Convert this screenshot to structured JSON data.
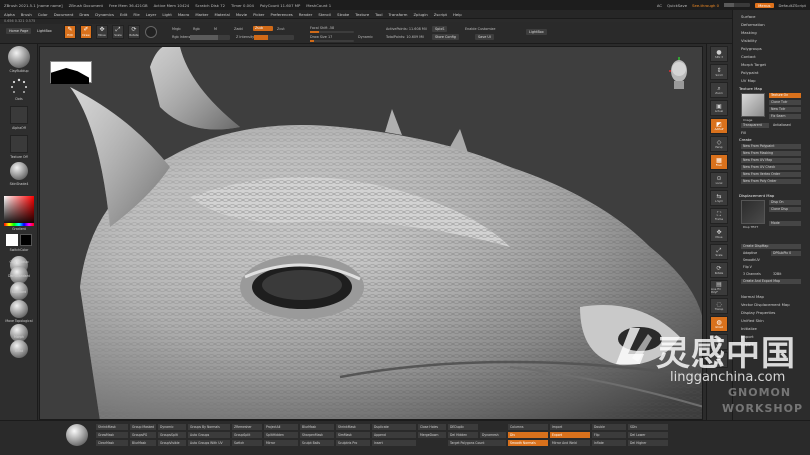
{
  "titlebar": {
    "app": "ZBrush 2021.5.1 [name name]",
    "doc": "ZBrush Document",
    "stats": [
      "Free Mem 36.421GB",
      "Active Mem 10424",
      "Scratch Disk 72",
      "Timer 0.004",
      "PolyCount 11.607 MP",
      "MeshCount 1"
    ],
    "ac": "AC",
    "quicksave": "QuickSave",
    "seethrough": "See-through 0",
    "menus": "Menus",
    "defaultzscript": "DefaultZScript"
  },
  "menubar": {
    "items": [
      "Alpha",
      "Brush",
      "Color",
      "Document",
      "Draw",
      "Dynamics",
      "Edit",
      "File",
      "Layer",
      "Light",
      "Macro",
      "Marker",
      "Material",
      "Movie",
      "Picker",
      "Preferences",
      "Render",
      "Stencil",
      "Stroke",
      "Texture",
      "Tool",
      "Transform",
      "Zplugin",
      "Zscript",
      "Help"
    ]
  },
  "infobar": "0.656 0.321 0.575",
  "toolbar": {
    "homepage": "Home Page",
    "lightbox": "LightBox",
    "edit": "Edit",
    "draw": "Draw",
    "move": "Move",
    "scale": "Scale",
    "rotate": "Rotate",
    "mrgb": "Mrgb",
    "rgb": "Rgb",
    "m": "M",
    "zadd": "Zadd",
    "zsub": "Zsub",
    "zcut": "Zcut",
    "rgb_intensity": "Rgb Intensity",
    "z_intensity": "Z Intensity 34",
    "focal_shift": "Focal Shift -58",
    "draw_size": "Draw Size 17",
    "dynamic": "Dynamic",
    "active_points": "ActivePoints: 11.608 Mil",
    "total_points": "TotalPoints: 10.609 Mil",
    "spix": "SpixS",
    "enable_customize": "Enable Customize",
    "store_config": "Store Config",
    "save_ui": "Save UI",
    "lightbox2": "LightBox"
  },
  "leftshelf": {
    "items": [
      "ClayBuildup",
      "Dots",
      "AlphaOff",
      "Texture Off",
      "SkinShade4",
      "Gradient",
      "SwitchColor",
      "ClayBuildup",
      "DamStandard",
      "Standard",
      "Move Topological",
      "Morph",
      "Inflat"
    ]
  },
  "rightshelf": {
    "items": [
      "SPix 3",
      "Scroll",
      "Zoom",
      "Actual",
      "AAHalf",
      "Persp",
      "Floor",
      "Local",
      "L.Sym",
      "Frame",
      "Move",
      "Scale",
      "Rotate",
      "Line Fill PolyF",
      "Transp",
      "Ghost",
      "Solo",
      "Xpose"
    ]
  },
  "panel": {
    "top_items": [
      "Surface",
      "Deformation",
      "Masking",
      "Visibility",
      "Polygroups",
      "Contact",
      "Morph Target",
      "Polypaint",
      "UV Map"
    ],
    "texture_map": "Texture Map",
    "texture_on": "Texture On",
    "clone_txtr": "Clone Txtr",
    "new_txtr": "New Txtr",
    "fix_seam": "Fix Seam",
    "image_plus": "Image",
    "transparent": "Transparent",
    "antialiased": "Antialiased",
    "fill": "Fill",
    "create": "Create",
    "create_items": [
      "New From Polypaint",
      "New From Masking",
      "New From UV Map",
      "New From UV Check",
      "New From Vertex Order",
      "New From Poly Order"
    ],
    "displacement_map": "Displacement Map",
    "disp_on": "Disp On",
    "clone_disp": "Clone Disp",
    "disp_label": "Disp TEXT",
    "mode": "Mode",
    "create_dispmap": "Create DispMap",
    "adaptive": "Adaptive",
    "dpsubpix": "DPSubPix 0",
    "smoothuv": "SmoothUV",
    "flip_v": "Flip V",
    "channels": "3 Channels",
    "bits": "32Bit",
    "create_export": "Create And Export Map",
    "bottom_items": [
      "Normal Map",
      "Vector Displacement Map",
      "Display Properties",
      "Unified Skin",
      "Initialize",
      "Import",
      "Export"
    ]
  },
  "bottombar": {
    "col1": [
      "ShrinkMask",
      "GrowMask",
      "ClearMask"
    ],
    "col2": [
      "Group Masked",
      "GroupsPG",
      "BlurMask"
    ],
    "col3": [
      "Dynamic",
      "GroupsSplit",
      "GroupVisible"
    ],
    "col4": [
      "Groups By Normals",
      "Auto Groups",
      "Auto Groups With UV"
    ],
    "col5": [
      "ZRemesher",
      "GroupSplit",
      "Switch"
    ],
    "col6": [
      "ProjectAll",
      "SplitHidden",
      "Mirror"
    ],
    "col7": [
      "BlurMask",
      "SharpenMask",
      "Sculpt Balls"
    ],
    "col8": [
      "ShrinkMask",
      "SimMask",
      "Sculptris Pro"
    ],
    "col9": [
      "Duplicate",
      "Append",
      "Insert"
    ],
    "col10": [
      "Close Holes",
      "MergeDown",
      "Target Polygons Count"
    ],
    "col11": [
      "DEDuplic",
      "Del Hidden",
      "Dynamesh"
    ],
    "col12": [
      "Columns",
      "Div",
      "Smooth Normals"
    ],
    "col13": [
      "Import",
      "Export",
      "Mirror And Weld"
    ],
    "col14": [
      "Double",
      "Flip",
      "Inflate"
    ],
    "col15": [
      "SDiv",
      "Del Lower",
      "Del Higher"
    ]
  },
  "watermark": {
    "chinese": "灵感中国",
    "url": "lingganchina.com",
    "gnomon": "GNOMON",
    "workshop": "WORKSHOP"
  },
  "colors": {
    "accent": "#d9711c",
    "background": "#2b2b2b",
    "viewport": "#3e3e3e"
  }
}
